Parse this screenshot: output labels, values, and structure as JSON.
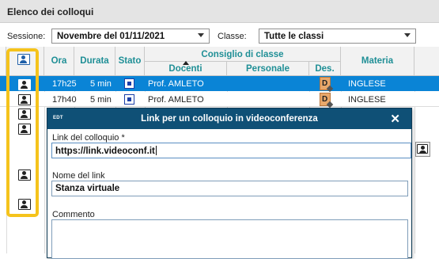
{
  "app": {
    "title": "Elenco dei colloqui"
  },
  "filters": {
    "session_label": "Sessione:",
    "session_value": "Novembre del 01/11/2021",
    "class_label": "Classe:",
    "class_value": "Tutte le classi"
  },
  "table": {
    "headers": {
      "ora": "Ora",
      "durata": "Durata",
      "stato": "Stato",
      "consiglio": "Consiglio di classe",
      "docenti": "Docenti",
      "personale": "Personale",
      "des": "Des.",
      "materia": "Materia"
    },
    "sort_column": "Docenti",
    "rows": [
      {
        "ora": "17h25",
        "durata": "5 min",
        "docente": "Prof. AMLETO",
        "des_icon": "D",
        "materia": "INGLESE",
        "selected": true
      },
      {
        "ora": "17h40",
        "durata": "5 min",
        "docente": "Prof. AMLETO",
        "des_icon": "D",
        "materia": "INGLESE",
        "selected": false
      }
    ],
    "icons": {
      "header": "videoconference-icon",
      "row": "videoconference-icon"
    }
  },
  "dialog": {
    "logo": "EDT",
    "title": "Link per un colloquio in videoconferenza",
    "close_label": "✕",
    "link_label": "Link del colloquio *",
    "link_value": "https://link.videoconf.it",
    "name_label": "Nome del link",
    "name_value": "Stanza virtuale",
    "comment_label": "Commento"
  },
  "colors": {
    "accent_teal": "#1f8f96",
    "selection_blue": "#0a84d6",
    "dialog_header": "#0f5076",
    "highlight_yellow": "#f5c31c"
  }
}
